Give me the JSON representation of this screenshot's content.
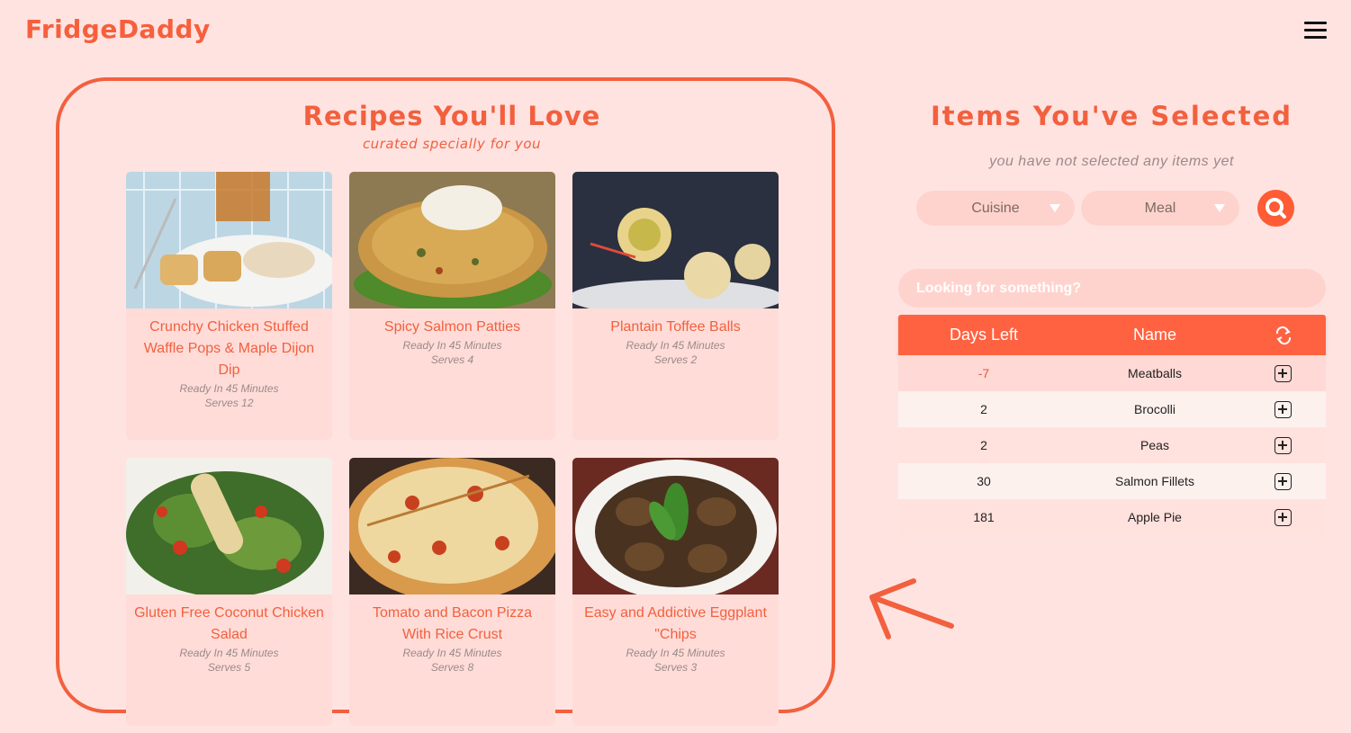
{
  "app": {
    "logo": "FridgeDaddy"
  },
  "recipes": {
    "title": "Recipes You'll Love",
    "subtitle": "curated specially for you",
    "cards": [
      {
        "title": "Crunchy Chicken Stuffed Waffle Pops & Maple Dijon Dip",
        "ready": "Ready In 45 Minutes",
        "serves": "Serves 12",
        "image": "waffle-pops-photo"
      },
      {
        "title": "Spicy Salmon Patties",
        "ready": "Ready In 45 Minutes",
        "serves": "Serves 4",
        "image": "salmon-patty-photo"
      },
      {
        "title": "Plantain Toffee Balls",
        "ready": "Ready In 45 Minutes",
        "serves": "Serves 2",
        "image": "toffee-balls-photo"
      },
      {
        "title": "Gluten Free Coconut Chicken Salad",
        "ready": "Ready In 45 Minutes",
        "serves": "Serves 5",
        "image": "chicken-salad-photo"
      },
      {
        "title": "Tomato and Bacon Pizza With Rice Crust",
        "ready": "Ready In 45 Minutes",
        "serves": "Serves 8",
        "image": "pizza-photo"
      },
      {
        "title": "Easy and Addictive Eggplant \"Chips",
        "ready": "Ready In 45 Minutes",
        "serves": "Serves 3",
        "image": "eggplant-chips-photo"
      }
    ]
  },
  "selected": {
    "title": "Items You've Selected",
    "empty_message": "you have not selected any items yet",
    "cuisine_label": "Cuisine",
    "meal_label": "Meal"
  },
  "search": {
    "placeholder": "Looking for something?"
  },
  "table": {
    "headers": {
      "days": "Days Left",
      "name": "Name",
      "sort_icon": "swap-icon"
    },
    "rows": [
      {
        "days": "-7",
        "name": "Meatballs"
      },
      {
        "days": "2",
        "name": "Brocolli"
      },
      {
        "days": "2",
        "name": "Peas"
      },
      {
        "days": "30",
        "name": "Salmon Fillets"
      },
      {
        "days": "181",
        "name": "Apple Pie"
      }
    ]
  },
  "colors": {
    "brand": "#f2603e",
    "background": "#ffe3e1",
    "expired": "#e8563a",
    "table_header": "#ff6240"
  }
}
